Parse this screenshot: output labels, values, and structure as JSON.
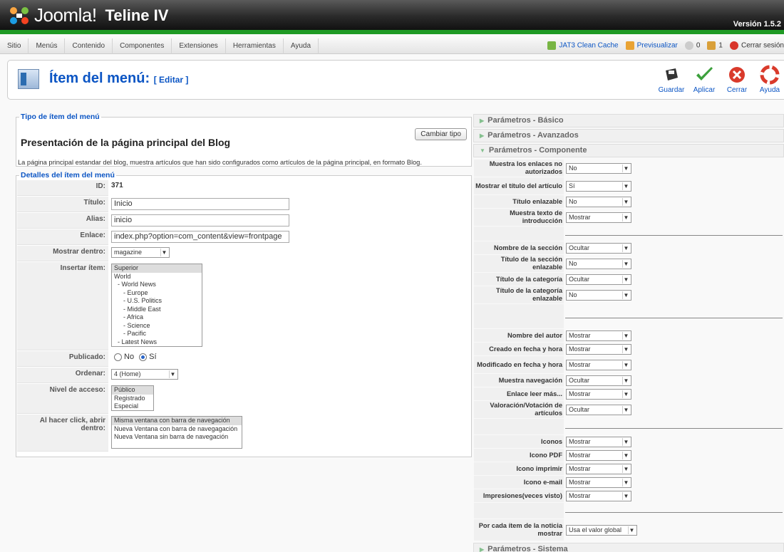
{
  "header": {
    "logo_text": "Joomla!",
    "site_name": "Teline IV",
    "version": "Versión 1.5.2"
  },
  "menubar": {
    "items": [
      "Sitio",
      "Menús",
      "Contenido",
      "Componentes",
      "Extensiones",
      "Herramientas",
      "Ayuda"
    ],
    "cache": "JAT3 Clean Cache",
    "preview": "Previsualizar",
    "messages": "0",
    "users": "1",
    "logout": "Cerrar sesión"
  },
  "toolbar": {
    "title": "Ítem del menú:",
    "subtitle": "[ Editar ]",
    "buttons": {
      "save": "Guardar",
      "apply": "Aplicar",
      "close": "Cerrar",
      "help": "Ayuda"
    }
  },
  "tipo": {
    "legend": "Tipo de ítem del menú",
    "change_button": "Cambiar tipo",
    "title": "Presentación de la página principal del Blog",
    "description": "La página principal estandar del blog, muestra artículos que han sido configurados como artículos de la página principal, en formato Blog."
  },
  "details": {
    "legend": "Detalles del ítem del menú",
    "id_label": "ID:",
    "id_value": "371",
    "titulo_label": "Título:",
    "titulo_value": "Inicio",
    "alias_label": "Alias:",
    "alias_value": "inicio",
    "enlace_label": "Enlace:",
    "enlace_value": "index.php?option=com_content&view=frontpage",
    "mostrar_label": "Mostrar dentro:",
    "mostrar_value": "magazine",
    "insertar_label": "Insertar ítem:",
    "insertar_options": [
      "Superior",
      "World",
      "- World News",
      "- Europe",
      "- U.S. Politics",
      "- Middle East",
      "- Africa",
      "- Science",
      "- Pacific",
      "- Latest News"
    ],
    "publicado_label": "Publicado:",
    "publicado_no": "No",
    "publicado_si": "Sí",
    "ordenar_label": "Ordenar:",
    "ordenar_value": "4 (Home)",
    "nivel_label": "Nivel de acceso:",
    "nivel_options": [
      "Público",
      "Registrado",
      "Especial"
    ],
    "click_label": "Al hacer click, abrir dentro:",
    "click_options": [
      "Misma ventana con barra de navegación",
      "Nueva Ventana con barra de navegagación",
      "Nueva Ventana sin barra de navegación"
    ]
  },
  "params": {
    "basico": "Parámetros - Básico",
    "avanzados": "Parámetros - Avanzados",
    "componente": "Parámetros - Componente",
    "sistema": "Parámetros - Sistema",
    "group1": [
      {
        "label": "Muestra los enlaces no autorizados",
        "value": "No"
      },
      {
        "label": "Mostrar el título del artículo",
        "value": "Sí"
      },
      {
        "label": "Título enlazable",
        "value": "No"
      },
      {
        "label": "Muestra texto de introducción",
        "value": "Mostrar"
      }
    ],
    "group2": [
      {
        "label": "Nombre de la sección",
        "value": "Ocultar"
      },
      {
        "label": "Título de la sección enlazable",
        "value": "No"
      },
      {
        "label": "Título de la categoría",
        "value": "Ocultar"
      },
      {
        "label": "Título de la categoría enlazable",
        "value": "No"
      }
    ],
    "group3": [
      {
        "label": "Nombre del autor",
        "value": "Mostrar"
      },
      {
        "label": "Creado en fecha y hora",
        "value": "Mostrar"
      },
      {
        "label": "Modificado en fecha y hora",
        "value": "Mostrar"
      },
      {
        "label": "Muestra navegación",
        "value": "Ocultar"
      },
      {
        "label": "Enlace leer más...",
        "value": "Mostrar"
      },
      {
        "label": "Valoración/Votación de artículos",
        "value": "Ocultar"
      }
    ],
    "group4": [
      {
        "label": "Iconos",
        "value": "Mostrar"
      },
      {
        "label": "Icono PDF",
        "value": "Mostrar"
      },
      {
        "label": "Icono imprimir",
        "value": "Mostrar"
      },
      {
        "label": "Icono e-mail",
        "value": "Mostrar"
      },
      {
        "label": "Impresiones(veces visto)",
        "value": "Mostrar"
      }
    ],
    "group5": [
      {
        "label": "Por cada ítem de la noticia mostrar",
        "value": "Usa el valor global"
      }
    ]
  }
}
